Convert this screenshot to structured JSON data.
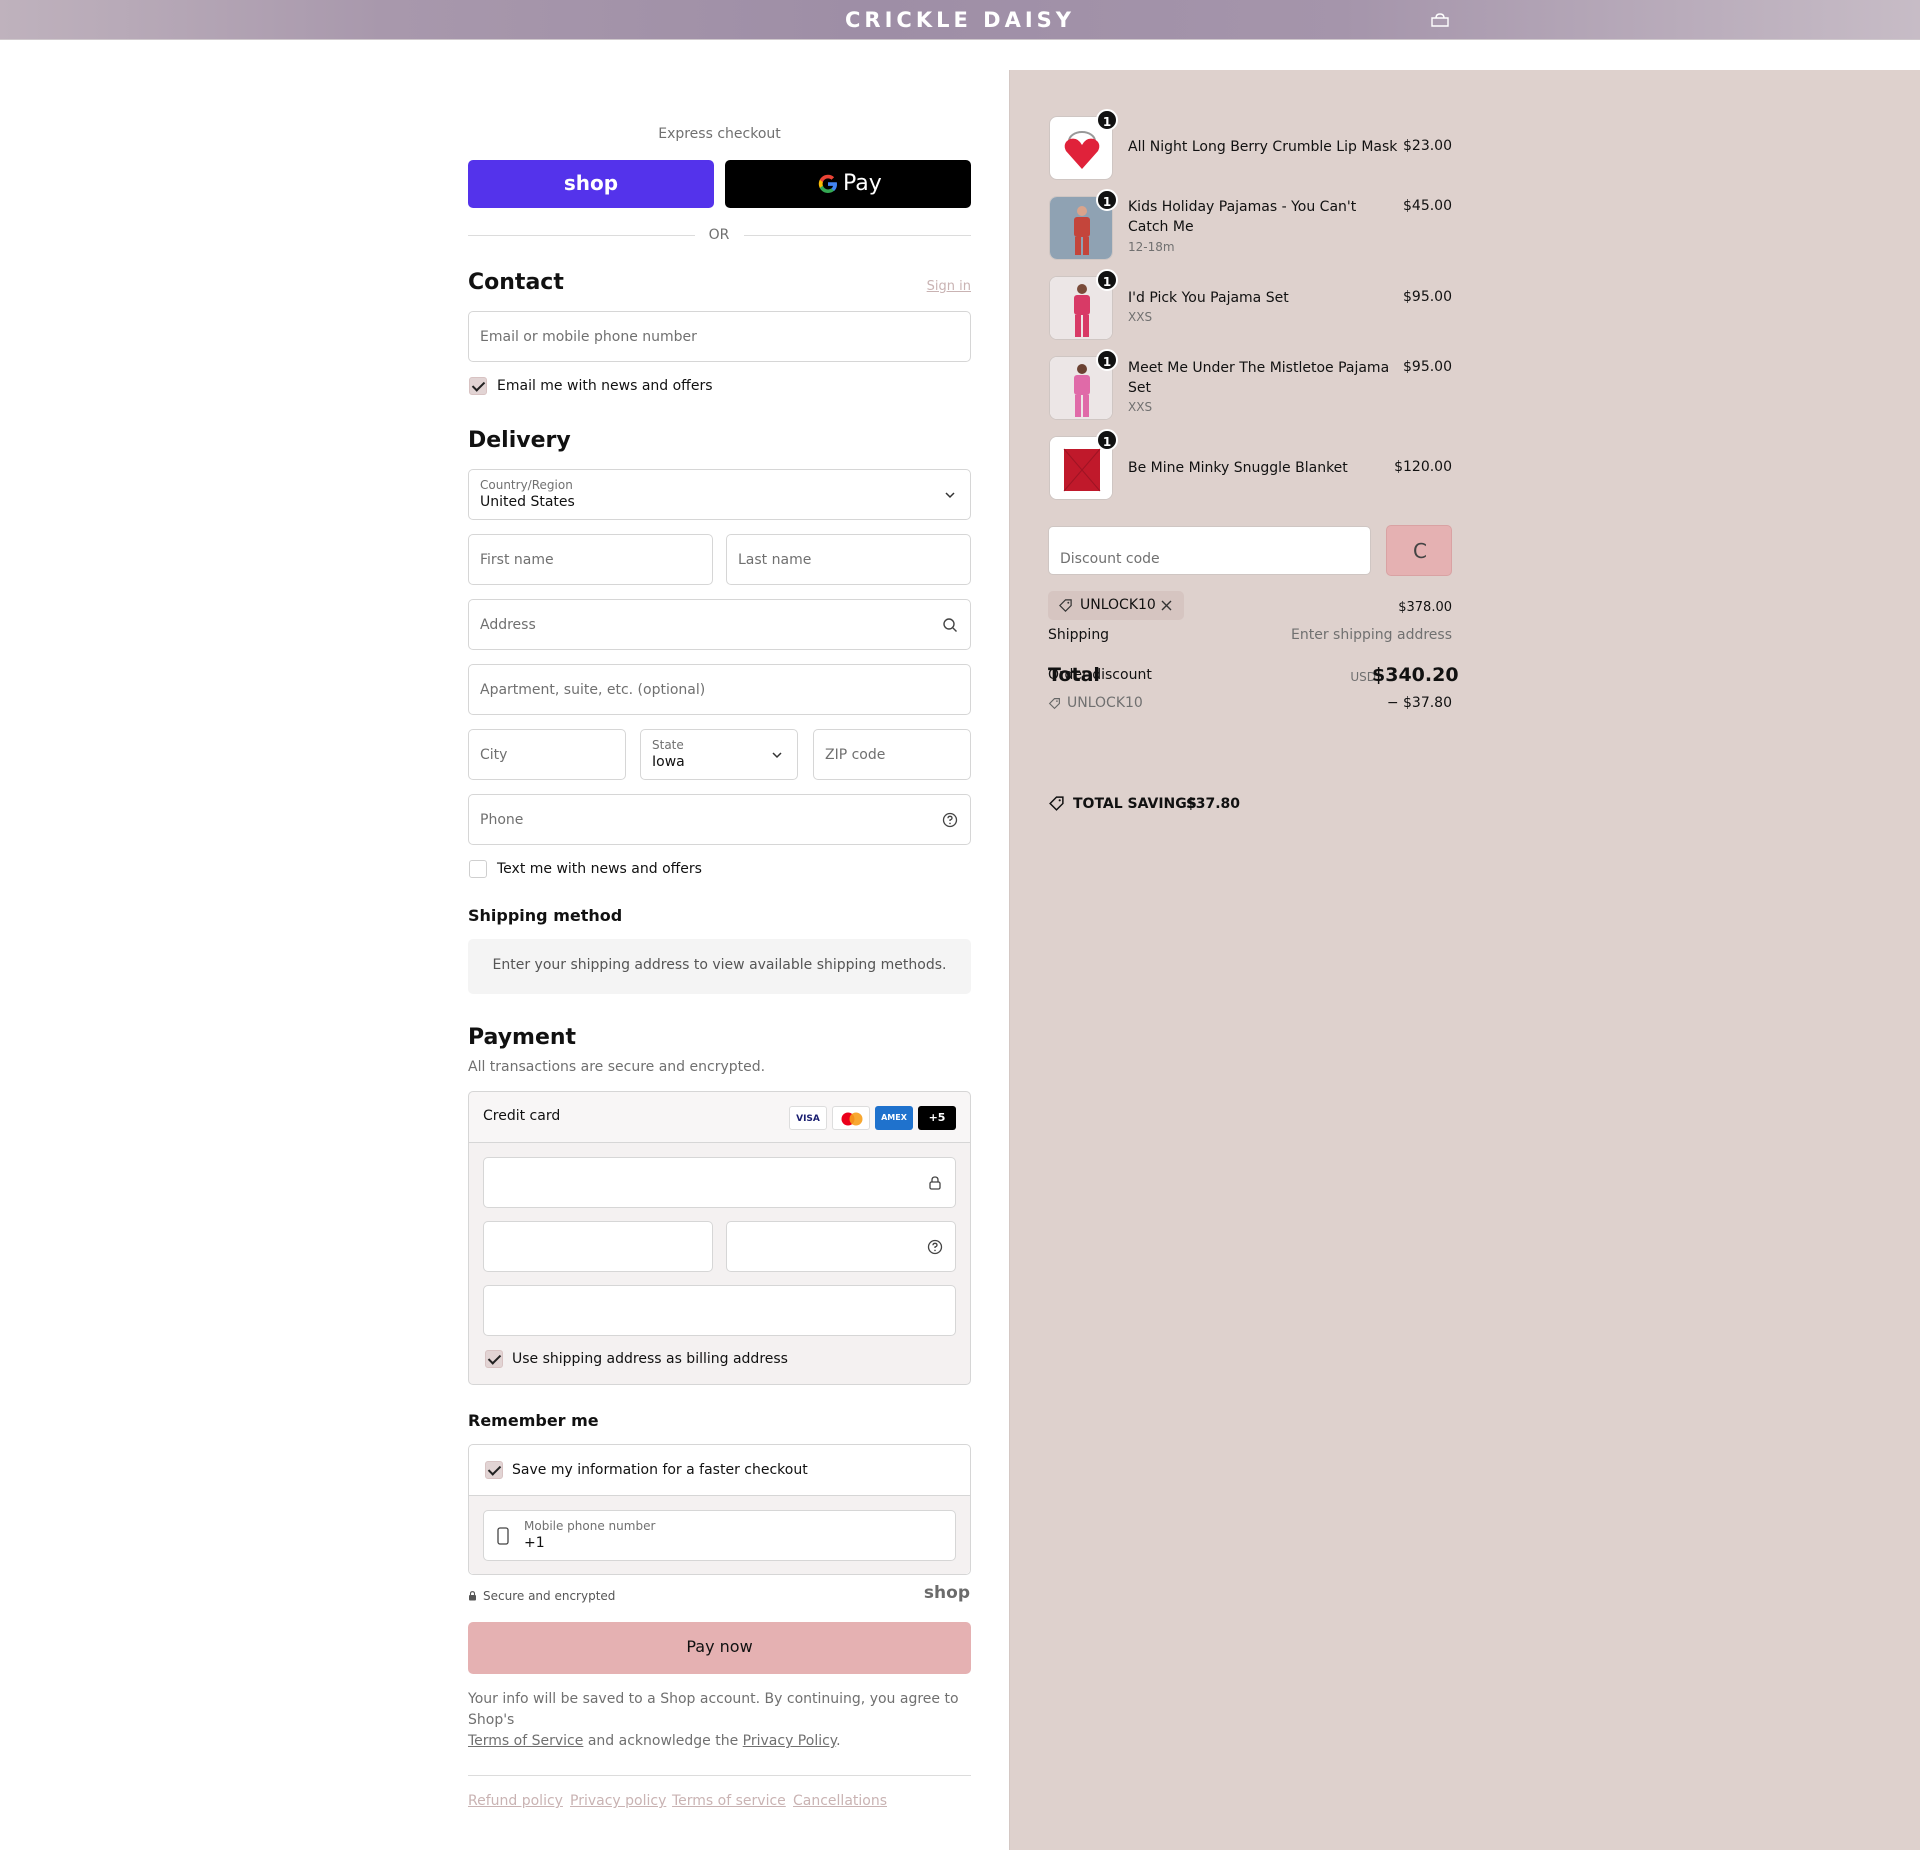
{
  "header": {
    "brand": "CRICKLE DAISY",
    "cart_icon": "shopping-bag-icon"
  },
  "express": {
    "label": "Express checkout",
    "shop_label": "shop",
    "gpay_label": "Pay",
    "or_label": "OR",
    "colors": {
      "shop": "#5433eb",
      "gpay": "#000000"
    }
  },
  "contact": {
    "title": "Contact",
    "sign_in": "Sign in",
    "email_placeholder": "Email or mobile phone number",
    "email_news_label": "Email me with news and offers",
    "email_news_checked": true
  },
  "delivery": {
    "title": "Delivery",
    "country_label": "Country/Region",
    "country_value": "United States",
    "first_name_placeholder": "First name",
    "last_name_placeholder": "Last name",
    "address_placeholder": "Address",
    "apartment_placeholder": "Apartment, suite, etc. (optional)",
    "city_placeholder": "City",
    "state_label": "State",
    "state_value": "Iowa",
    "zip_placeholder": "ZIP code",
    "phone_placeholder": "Phone",
    "text_news_label": "Text me with news and offers",
    "text_news_checked": false
  },
  "shipping_method": {
    "title": "Shipping method",
    "message": "Enter your shipping address to view available shipping methods."
  },
  "payment": {
    "title": "Payment",
    "subtitle": "All transactions are secure and encrypted.",
    "method_label": "Credit card",
    "cards": [
      "VISA",
      "",
      "AMEX",
      "+5"
    ],
    "billing_label": "Use shipping address as billing address",
    "billing_checked": true
  },
  "remember": {
    "title": "Remember me",
    "save_label": "Save my information for a faster checkout",
    "save_checked": true,
    "mobile_label": "Mobile phone number",
    "mobile_value": "+1",
    "secure_label": "Secure and encrypted",
    "shop_logo": "shop"
  },
  "pay_now": {
    "label": "Pay now",
    "color": "#e5b1b2"
  },
  "legal": {
    "text_1": "Your info will be saved to a Shop account. By continuing, you agree to Shop's",
    "terms": "Terms of Service",
    "text_2": "and acknowledge the",
    "privacy": "Privacy Policy",
    "text_3": "."
  },
  "footer_links": [
    "Refund policy",
    "Privacy policy",
    "Terms of service",
    "Cancellations"
  ],
  "summary": {
    "items": [
      {
        "name": "All Night Long Berry Crumble Lip Mask",
        "variant": "",
        "price": "$23.00",
        "qty": "1"
      },
      {
        "name": "Kids Holiday Pajamas - You Can't Catch Me",
        "variant": "12-18m",
        "price": "$45.00",
        "qty": "1"
      },
      {
        "name": "I'd Pick You Pajama Set",
        "variant": "XXS",
        "price": "$95.00",
        "qty": "1"
      },
      {
        "name": "Meet Me Under The Mistletoe Pajama Set",
        "variant": "XXS",
        "price": "$95.00",
        "qty": "1"
      },
      {
        "name": "Be Mine Minky Snuggle Blanket",
        "variant": "",
        "price": "$120.00",
        "qty": "1"
      }
    ],
    "discount_placeholder": "Discount code",
    "apply_label": "C",
    "code_tag": "UNLOCK10",
    "subtotal_value": "$378.00",
    "shipping_label": "Shipping",
    "shipping_value": "Enter shipping address",
    "total_label": "Total",
    "order_discount_label": "Order discount",
    "currency": "USD",
    "total_value": "$340.20",
    "discount_code_line": "UNLOCK10",
    "discount_value": "− $37.80",
    "savings_label": "TOTAL SAVINGS",
    "savings_value": "$37.80"
  }
}
